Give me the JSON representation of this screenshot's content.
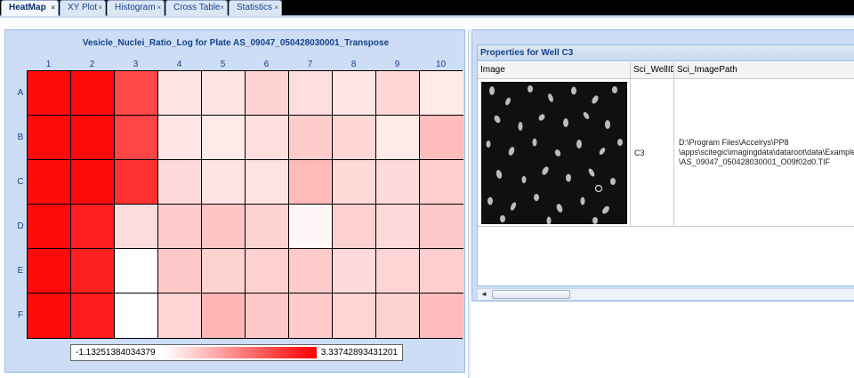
{
  "tabs": [
    {
      "label": "HeatMap",
      "active": true
    },
    {
      "label": "XY Plot",
      "active": false
    },
    {
      "label": "Histogram",
      "active": false
    },
    {
      "label": "Cross Table",
      "active": false
    },
    {
      "label": "Statistics",
      "active": false
    }
  ],
  "heatmap": {
    "title": "Vesicle_Nuclei_Ratio_Log for Plate AS_09047_050428030001_Transpose",
    "columns": [
      "1",
      "2",
      "3",
      "4",
      "5",
      "6",
      "7",
      "8",
      "9",
      "10"
    ],
    "rows": [
      "A",
      "B",
      "C",
      "D",
      "E",
      "F"
    ],
    "cell_colors": [
      [
        "#ff0a0a",
        "#ff0a0a",
        "#ff4848",
        "#ffe2e2",
        "#ffe4e4",
        "#ffd3d3",
        "#ffdede",
        "#ffe6e6",
        "#ffd6d6",
        "#ffe9e9"
      ],
      [
        "#ff0a0a",
        "#ff0a0a",
        "#ff4545",
        "#ffe5e5",
        "#ffeaea",
        "#ffdede",
        "#ffcccc",
        "#ffd6d6",
        "#ffeaea",
        "#ffbcbc"
      ],
      [
        "#ff0a0a",
        "#ff0a0a",
        "#ff3030",
        "#ffd9d9",
        "#ffe4e4",
        "#ffe2e2",
        "#ffbaba",
        "#ffd8d8",
        "#ffdada",
        "#ffcfcf"
      ],
      [
        "#ff0a0a",
        "#ff1e1e",
        "#ffdcdc",
        "#ffcccc",
        "#ffc4c4",
        "#ffd2d2",
        "#fff7f7",
        "#ffd0d0",
        "#ffd9d9",
        "#ffc8c8"
      ],
      [
        "#ff0a0a",
        "#ff2020",
        "#ffffff",
        "#ffc8c8",
        "#ffd2d2",
        "#ffd0d0",
        "#ffcaca",
        "#ffdada",
        "#ffd4d4",
        "#ffcece"
      ],
      [
        "#ff0a0a",
        "#ff1c1c",
        "#ffffff",
        "#ffd4d4",
        "#ffb6b6",
        "#ffc8c8",
        "#ffcaca",
        "#ffd4d4",
        "#ffd2d2",
        "#ffbcbc"
      ]
    ],
    "legend_min": "-1.13251384034379",
    "legend_max": "3.33742893431201",
    "legend_colors": {
      "min": "#ffffff",
      "max": "#ff0000"
    }
  },
  "properties": {
    "title": "Properties for Well C3",
    "headers": {
      "image": "Image",
      "well_id": "Sci_WellID",
      "image_path": "Sci_ImagePath"
    },
    "well_id": "C3",
    "path_lines": [
      "D:\\Program Files\\Accelrys\\PP8",
      "\\apps\\scitegic\\imagingdata\\dataroot\\data\\Example_",
      "\\AS_09047_050428030001_O09f02d0.TIF"
    ]
  },
  "accent": "#15428b",
  "close_glyph": "×",
  "scroll_left_glyph": "◄"
}
